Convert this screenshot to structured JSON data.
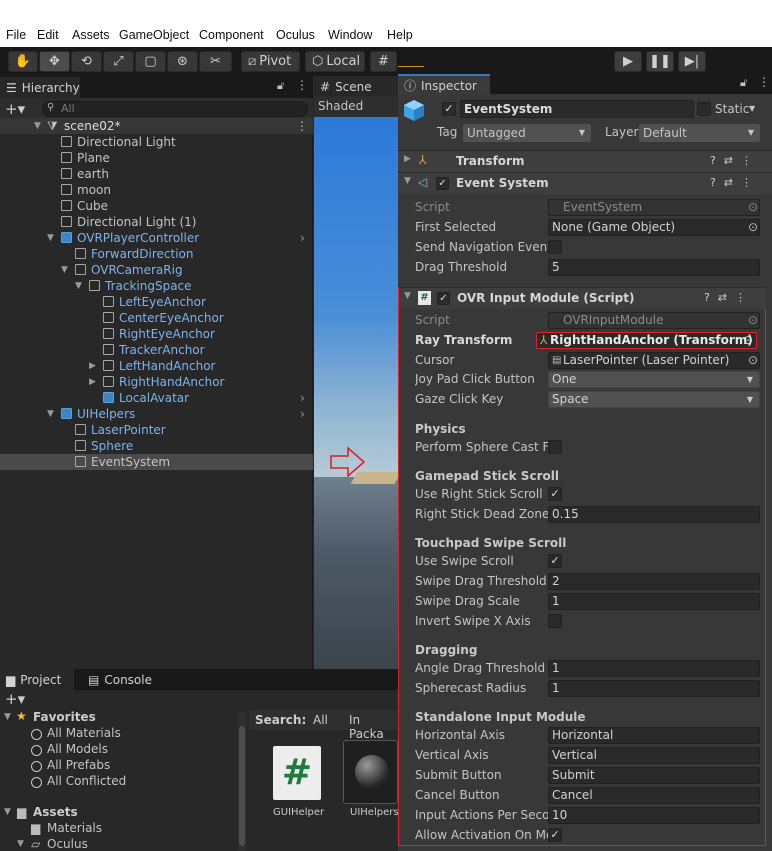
{
  "menu": [
    "File",
    "Edit",
    "Assets",
    "GameObject",
    "Component",
    "Oculus",
    "Window",
    "Help"
  ],
  "toolbar": {
    "pivot": "Pivot",
    "local": "Local"
  },
  "hierarchy": {
    "tab": "Hierarchy",
    "search_placeholder": "All",
    "scene": "scene02*",
    "items": [
      {
        "label": "Directional Light",
        "blue": false
      },
      {
        "label": "Plane",
        "blue": false
      },
      {
        "label": "earth",
        "blue": false
      },
      {
        "label": "moon",
        "blue": false
      },
      {
        "label": "Cube",
        "blue": false
      },
      {
        "label": "Directional Light (1)",
        "blue": false
      },
      {
        "label": "OVRPlayerController",
        "blue": true
      },
      {
        "label": "ForwardDirection",
        "blue": true
      },
      {
        "label": "OVRCameraRig",
        "blue": true
      },
      {
        "label": "TrackingSpace",
        "blue": true
      },
      {
        "label": "LeftEyeAnchor",
        "blue": true
      },
      {
        "label": "CenterEyeAnchor",
        "blue": true
      },
      {
        "label": "RightEyeAnchor",
        "blue": true
      },
      {
        "label": "TrackerAnchor",
        "blue": true
      },
      {
        "label": "LeftHandAnchor",
        "blue": true
      },
      {
        "label": "RightHandAnchor",
        "blue": true
      },
      {
        "label": "LocalAvatar",
        "blue": true
      },
      {
        "label": "UIHelpers",
        "blue": true
      },
      {
        "label": "LaserPointer",
        "blue": true
      },
      {
        "label": "Sphere",
        "blue": true
      },
      {
        "label": "EventSystem",
        "blue": false
      }
    ]
  },
  "scene": {
    "tab": "Scene",
    "mode": "Shaded"
  },
  "inspector": {
    "tab": "Inspector",
    "object_name": "EventSystem",
    "static_label": "Static",
    "tag_label": "Tag",
    "tag_value": "Untagged",
    "layer_label": "Layer",
    "layer_value": "Default",
    "transform": "Transform",
    "event_system": {
      "title": "Event System",
      "script_label": "Script",
      "script_value": "EventSystem",
      "first_selected_label": "First Selected",
      "first_selected_value": "None (Game Object)",
      "send_nav_label": "Send Navigation Events",
      "drag_threshold_label": "Drag Threshold",
      "drag_threshold_value": "5"
    },
    "ovr": {
      "title": "OVR Input Module (Script)",
      "script_label": "Script",
      "script_value": "OVRInputModule",
      "ray_label": "Ray Transform",
      "ray_value": "RightHandAnchor (Transform)",
      "cursor_label": "Cursor",
      "cursor_value": "LaserPointer (Laser Pointer)",
      "joypad_label": "Joy Pad Click Button",
      "joypad_value": "One",
      "gaze_label": "Gaze Click Key",
      "gaze_value": "Space",
      "physics": "Physics",
      "sphere_cast_label": "Perform Sphere Cast For",
      "gamepad": "Gamepad Stick Scroll",
      "use_right_stick_label": "Use Right Stick Scroll",
      "right_dead_label": "Right Stick Dead Zone",
      "right_dead_value": "0.15",
      "touchpad": "Touchpad Swipe Scroll",
      "use_swipe_label": "Use Swipe Scroll",
      "swipe_thresh_label": "Swipe Drag Threshold",
      "swipe_thresh_value": "2",
      "swipe_scale_label": "Swipe Drag Scale",
      "swipe_scale_value": "1",
      "invert_label": "Invert Swipe X Axis",
      "dragging": "Dragging",
      "angle_label": "Angle Drag Threshold",
      "angle_value": "1",
      "spherecast_label": "Spherecast Radius",
      "spherecast_value": "1",
      "standalone": "Standalone Input Module",
      "horiz_label": "Horizontal Axis",
      "horiz_value": "Horizontal",
      "vert_label": "Vertical Axis",
      "vert_value": "Vertical",
      "submit_label": "Submit Button",
      "submit_value": "Submit",
      "cancel_label": "Cancel Button",
      "cancel_value": "Cancel",
      "iaps_label": "Input Actions Per Second",
      "iaps_value": "10",
      "allow_label": "Allow Activation On Mobile"
    }
  },
  "project": {
    "tab": "Project",
    "console_tab": "Console",
    "favorites": "Favorites",
    "fav_items": [
      "All Materials",
      "All Models",
      "All Prefabs",
      "All Conflicted"
    ],
    "assets": "Assets",
    "asset_items": [
      "Materials",
      "Oculus"
    ],
    "search_label": "Search:",
    "search_all": "All",
    "search_in": "In Packa",
    "files": [
      "GUIHelper",
      "UIHelpers"
    ]
  },
  "colors": {
    "highlight_border": "#e0232b",
    "hier_selected": "#4a4a4a"
  }
}
